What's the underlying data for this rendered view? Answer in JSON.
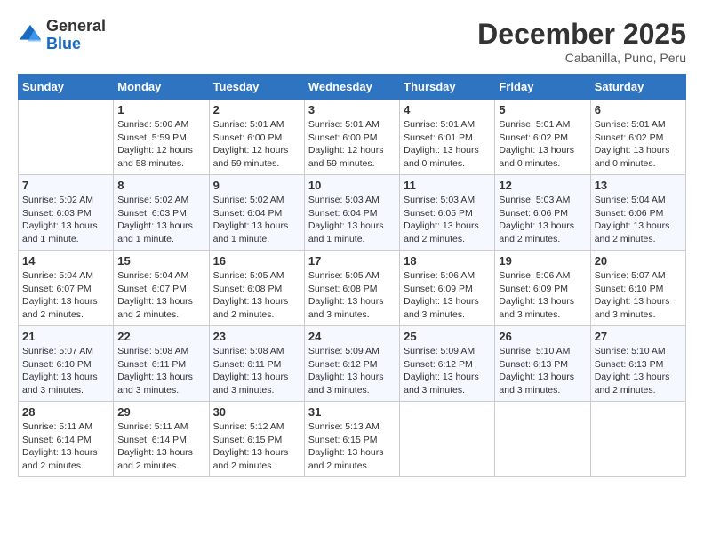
{
  "logo": {
    "general": "General",
    "blue": "Blue"
  },
  "title": "December 2025",
  "subtitle": "Cabanilla, Puno, Peru",
  "days_of_week": [
    "Sunday",
    "Monday",
    "Tuesday",
    "Wednesday",
    "Thursday",
    "Friday",
    "Saturday"
  ],
  "weeks": [
    [
      {
        "day": "",
        "sunrise": "",
        "sunset": "",
        "daylight": ""
      },
      {
        "day": "1",
        "sunrise": "Sunrise: 5:00 AM",
        "sunset": "Sunset: 5:59 PM",
        "daylight": "Daylight: 12 hours and 58 minutes."
      },
      {
        "day": "2",
        "sunrise": "Sunrise: 5:01 AM",
        "sunset": "Sunset: 6:00 PM",
        "daylight": "Daylight: 12 hours and 59 minutes."
      },
      {
        "day": "3",
        "sunrise": "Sunrise: 5:01 AM",
        "sunset": "Sunset: 6:00 PM",
        "daylight": "Daylight: 12 hours and 59 minutes."
      },
      {
        "day": "4",
        "sunrise": "Sunrise: 5:01 AM",
        "sunset": "Sunset: 6:01 PM",
        "daylight": "Daylight: 13 hours and 0 minutes."
      },
      {
        "day": "5",
        "sunrise": "Sunrise: 5:01 AM",
        "sunset": "Sunset: 6:02 PM",
        "daylight": "Daylight: 13 hours and 0 minutes."
      },
      {
        "day": "6",
        "sunrise": "Sunrise: 5:01 AM",
        "sunset": "Sunset: 6:02 PM",
        "daylight": "Daylight: 13 hours and 0 minutes."
      }
    ],
    [
      {
        "day": "7",
        "sunrise": "Sunrise: 5:02 AM",
        "sunset": "Sunset: 6:03 PM",
        "daylight": "Daylight: 13 hours and 1 minute."
      },
      {
        "day": "8",
        "sunrise": "Sunrise: 5:02 AM",
        "sunset": "Sunset: 6:03 PM",
        "daylight": "Daylight: 13 hours and 1 minute."
      },
      {
        "day": "9",
        "sunrise": "Sunrise: 5:02 AM",
        "sunset": "Sunset: 6:04 PM",
        "daylight": "Daylight: 13 hours and 1 minute."
      },
      {
        "day": "10",
        "sunrise": "Sunrise: 5:03 AM",
        "sunset": "Sunset: 6:04 PM",
        "daylight": "Daylight: 13 hours and 1 minute."
      },
      {
        "day": "11",
        "sunrise": "Sunrise: 5:03 AM",
        "sunset": "Sunset: 6:05 PM",
        "daylight": "Daylight: 13 hours and 2 minutes."
      },
      {
        "day": "12",
        "sunrise": "Sunrise: 5:03 AM",
        "sunset": "Sunset: 6:06 PM",
        "daylight": "Daylight: 13 hours and 2 minutes."
      },
      {
        "day": "13",
        "sunrise": "Sunrise: 5:04 AM",
        "sunset": "Sunset: 6:06 PM",
        "daylight": "Daylight: 13 hours and 2 minutes."
      }
    ],
    [
      {
        "day": "14",
        "sunrise": "Sunrise: 5:04 AM",
        "sunset": "Sunset: 6:07 PM",
        "daylight": "Daylight: 13 hours and 2 minutes."
      },
      {
        "day": "15",
        "sunrise": "Sunrise: 5:04 AM",
        "sunset": "Sunset: 6:07 PM",
        "daylight": "Daylight: 13 hours and 2 minutes."
      },
      {
        "day": "16",
        "sunrise": "Sunrise: 5:05 AM",
        "sunset": "Sunset: 6:08 PM",
        "daylight": "Daylight: 13 hours and 2 minutes."
      },
      {
        "day": "17",
        "sunrise": "Sunrise: 5:05 AM",
        "sunset": "Sunset: 6:08 PM",
        "daylight": "Daylight: 13 hours and 3 minutes."
      },
      {
        "day": "18",
        "sunrise": "Sunrise: 5:06 AM",
        "sunset": "Sunset: 6:09 PM",
        "daylight": "Daylight: 13 hours and 3 minutes."
      },
      {
        "day": "19",
        "sunrise": "Sunrise: 5:06 AM",
        "sunset": "Sunset: 6:09 PM",
        "daylight": "Daylight: 13 hours and 3 minutes."
      },
      {
        "day": "20",
        "sunrise": "Sunrise: 5:07 AM",
        "sunset": "Sunset: 6:10 PM",
        "daylight": "Daylight: 13 hours and 3 minutes."
      }
    ],
    [
      {
        "day": "21",
        "sunrise": "Sunrise: 5:07 AM",
        "sunset": "Sunset: 6:10 PM",
        "daylight": "Daylight: 13 hours and 3 minutes."
      },
      {
        "day": "22",
        "sunrise": "Sunrise: 5:08 AM",
        "sunset": "Sunset: 6:11 PM",
        "daylight": "Daylight: 13 hours and 3 minutes."
      },
      {
        "day": "23",
        "sunrise": "Sunrise: 5:08 AM",
        "sunset": "Sunset: 6:11 PM",
        "daylight": "Daylight: 13 hours and 3 minutes."
      },
      {
        "day": "24",
        "sunrise": "Sunrise: 5:09 AM",
        "sunset": "Sunset: 6:12 PM",
        "daylight": "Daylight: 13 hours and 3 minutes."
      },
      {
        "day": "25",
        "sunrise": "Sunrise: 5:09 AM",
        "sunset": "Sunset: 6:12 PM",
        "daylight": "Daylight: 13 hours and 3 minutes."
      },
      {
        "day": "26",
        "sunrise": "Sunrise: 5:10 AM",
        "sunset": "Sunset: 6:13 PM",
        "daylight": "Daylight: 13 hours and 3 minutes."
      },
      {
        "day": "27",
        "sunrise": "Sunrise: 5:10 AM",
        "sunset": "Sunset: 6:13 PM",
        "daylight": "Daylight: 13 hours and 2 minutes."
      }
    ],
    [
      {
        "day": "28",
        "sunrise": "Sunrise: 5:11 AM",
        "sunset": "Sunset: 6:14 PM",
        "daylight": "Daylight: 13 hours and 2 minutes."
      },
      {
        "day": "29",
        "sunrise": "Sunrise: 5:11 AM",
        "sunset": "Sunset: 6:14 PM",
        "daylight": "Daylight: 13 hours and 2 minutes."
      },
      {
        "day": "30",
        "sunrise": "Sunrise: 5:12 AM",
        "sunset": "Sunset: 6:15 PM",
        "daylight": "Daylight: 13 hours and 2 minutes."
      },
      {
        "day": "31",
        "sunrise": "Sunrise: 5:13 AM",
        "sunset": "Sunset: 6:15 PM",
        "daylight": "Daylight: 13 hours and 2 minutes."
      },
      {
        "day": "",
        "sunrise": "",
        "sunset": "",
        "daylight": ""
      },
      {
        "day": "",
        "sunrise": "",
        "sunset": "",
        "daylight": ""
      },
      {
        "day": "",
        "sunrise": "",
        "sunset": "",
        "daylight": ""
      }
    ]
  ]
}
